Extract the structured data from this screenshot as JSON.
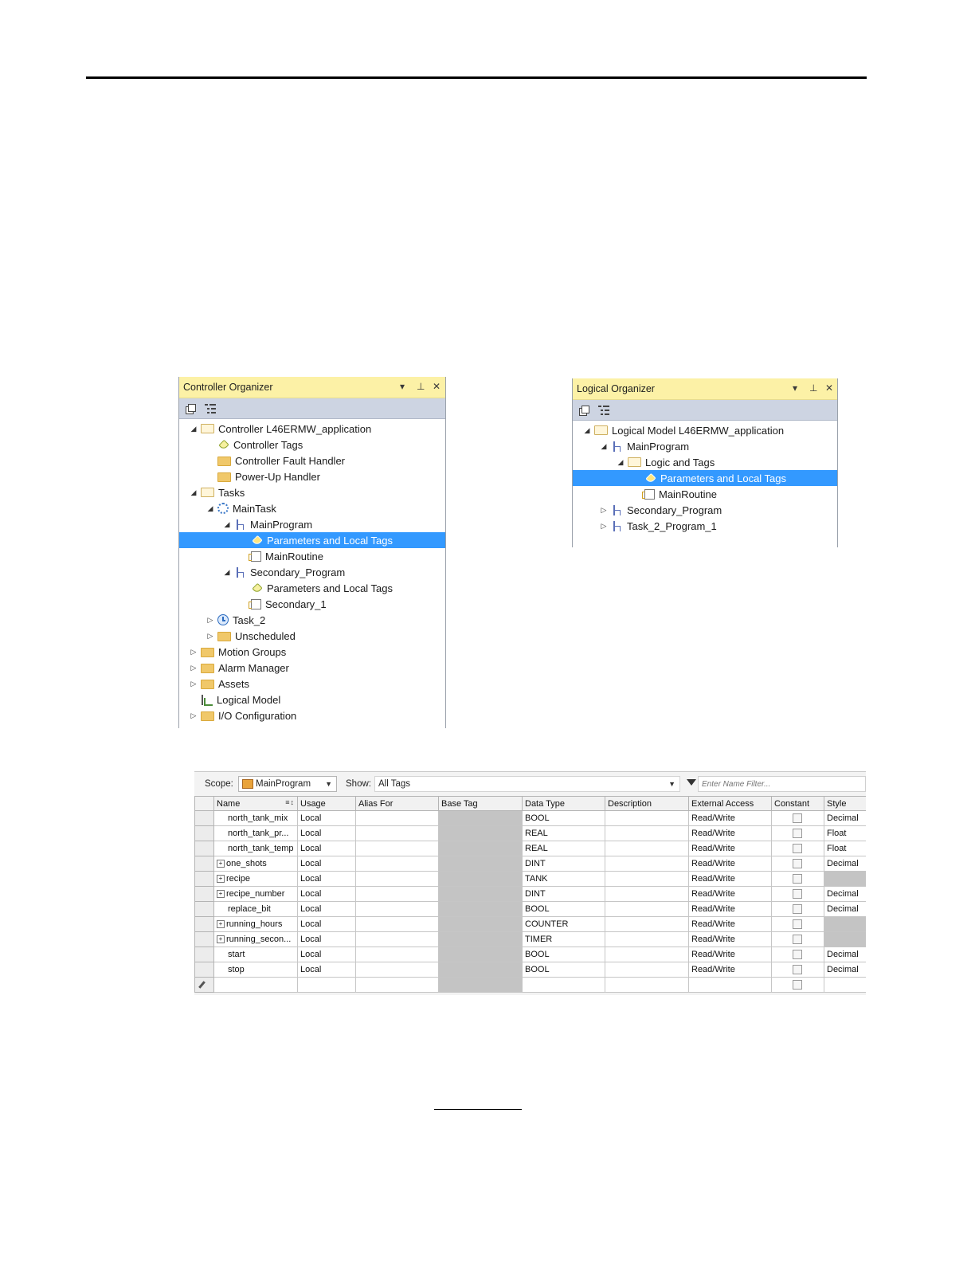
{
  "controller_organizer": {
    "title": "Controller Organizer",
    "items": [
      {
        "label": "Controller L46ERMW_application",
        "icon": "folder-open-icon",
        "toggle": "expanded",
        "level": 0
      },
      {
        "label": "Controller Tags",
        "icon": "tag-icon",
        "toggle": "none",
        "level": 1
      },
      {
        "label": "Controller Fault Handler",
        "icon": "folder-icon",
        "toggle": "none",
        "level": 1
      },
      {
        "label": "Power-Up Handler",
        "icon": "folder-icon",
        "toggle": "none",
        "level": 1
      },
      {
        "label": "Tasks",
        "icon": "folder-open-icon",
        "toggle": "expanded",
        "level": 0
      },
      {
        "label": "MainTask",
        "icon": "continuous-task-icon",
        "toggle": "expanded",
        "level": 1
      },
      {
        "label": "MainProgram",
        "icon": "program-icon",
        "toggle": "expanded",
        "level": 2
      },
      {
        "label": "Parameters and Local Tags",
        "icon": "tag-icon",
        "toggle": "none",
        "level": 3,
        "selected": true
      },
      {
        "label": "MainRoutine",
        "icon": "routine-icon",
        "toggle": "none",
        "level": 3
      },
      {
        "label": "Secondary_Program",
        "icon": "program-icon",
        "toggle": "expanded",
        "level": 2
      },
      {
        "label": "Parameters and Local Tags",
        "icon": "tag-icon",
        "toggle": "none",
        "level": 3
      },
      {
        "label": "Secondary_1",
        "icon": "routine-icon",
        "toggle": "none",
        "level": 3
      },
      {
        "label": "Task_2",
        "icon": "periodic-task-icon",
        "toggle": "collapsed",
        "level": 1
      },
      {
        "label": "Unscheduled",
        "icon": "folder-icon",
        "toggle": "collapsed",
        "level": 1
      },
      {
        "label": "Motion Groups",
        "icon": "folder-icon",
        "toggle": "collapsed",
        "level": 0
      },
      {
        "label": "Alarm Manager",
        "icon": "folder-icon",
        "toggle": "collapsed",
        "level": 0
      },
      {
        "label": "Assets",
        "icon": "folder-icon",
        "toggle": "collapsed",
        "level": 0
      },
      {
        "label": "Logical Model",
        "icon": "logical-model-icon",
        "toggle": "none",
        "level": 0
      },
      {
        "label": "I/O Configuration",
        "icon": "folder-icon",
        "toggle": "collapsed",
        "level": 0
      }
    ]
  },
  "logical_organizer": {
    "title": "Logical Organizer",
    "items": [
      {
        "label": "Logical Model L46ERMW_application",
        "icon": "folder-open-icon",
        "toggle": "expanded",
        "level": 0
      },
      {
        "label": "MainProgram",
        "icon": "program-icon",
        "toggle": "expanded",
        "level": 1
      },
      {
        "label": "Logic and Tags",
        "icon": "folder-open-icon",
        "toggle": "expanded",
        "level": 2
      },
      {
        "label": "Parameters and Local Tags",
        "icon": "tag-icon",
        "toggle": "none",
        "level": 3,
        "selected": true
      },
      {
        "label": "MainRoutine",
        "icon": "routine-icon",
        "toggle": "none",
        "level": 3
      },
      {
        "label": "Secondary_Program",
        "icon": "program-icon",
        "toggle": "collapsed",
        "level": 1
      },
      {
        "label": "Task_2_Program_1",
        "icon": "program-icon",
        "toggle": "collapsed",
        "level": 1
      }
    ]
  },
  "tag_editor": {
    "scope_label": "Scope:",
    "scope_value": "MainProgram",
    "show_label": "Show:",
    "show_value": "All Tags",
    "filter_placeholder": "Enter Name Filter...",
    "columns": [
      "Name",
      "Usage",
      "Alias For",
      "Base Tag",
      "Data Type",
      "Description",
      "External Access",
      "Constant",
      "Style"
    ],
    "rows": [
      {
        "name": "north_tank_mix",
        "expandable": false,
        "usage": "Local",
        "data_type": "BOOL",
        "external_access": "Read/Write",
        "style": "Decimal"
      },
      {
        "name": "north_tank_pr...",
        "expandable": false,
        "usage": "Local",
        "data_type": "REAL",
        "external_access": "Read/Write",
        "style": "Float"
      },
      {
        "name": "north_tank_temp",
        "expandable": false,
        "usage": "Local",
        "data_type": "REAL",
        "external_access": "Read/Write",
        "style": "Float"
      },
      {
        "name": "one_shots",
        "expandable": true,
        "usage": "Local",
        "data_type": "DINT",
        "external_access": "Read/Write",
        "style": "Decimal"
      },
      {
        "name": "recipe",
        "expandable": true,
        "usage": "Local",
        "data_type": "TANK",
        "external_access": "Read/Write",
        "style": ""
      },
      {
        "name": "recipe_number",
        "expandable": true,
        "usage": "Local",
        "data_type": "DINT",
        "external_access": "Read/Write",
        "style": "Decimal"
      },
      {
        "name": "replace_bit",
        "expandable": false,
        "usage": "Local",
        "data_type": "BOOL",
        "external_access": "Read/Write",
        "style": "Decimal"
      },
      {
        "name": "running_hours",
        "expandable": true,
        "usage": "Local",
        "data_type": "COUNTER",
        "external_access": "Read/Write",
        "style": ""
      },
      {
        "name": "running_secon...",
        "expandable": true,
        "usage": "Local",
        "data_type": "TIMER",
        "external_access": "Read/Write",
        "style": ""
      },
      {
        "name": "start",
        "expandable": false,
        "usage": "Local",
        "data_type": "BOOL",
        "external_access": "Read/Write",
        "style": "Decimal"
      },
      {
        "name": "stop",
        "expandable": false,
        "usage": "Local",
        "data_type": "BOOL",
        "external_access": "Read/Write",
        "style": "Decimal"
      }
    ]
  }
}
